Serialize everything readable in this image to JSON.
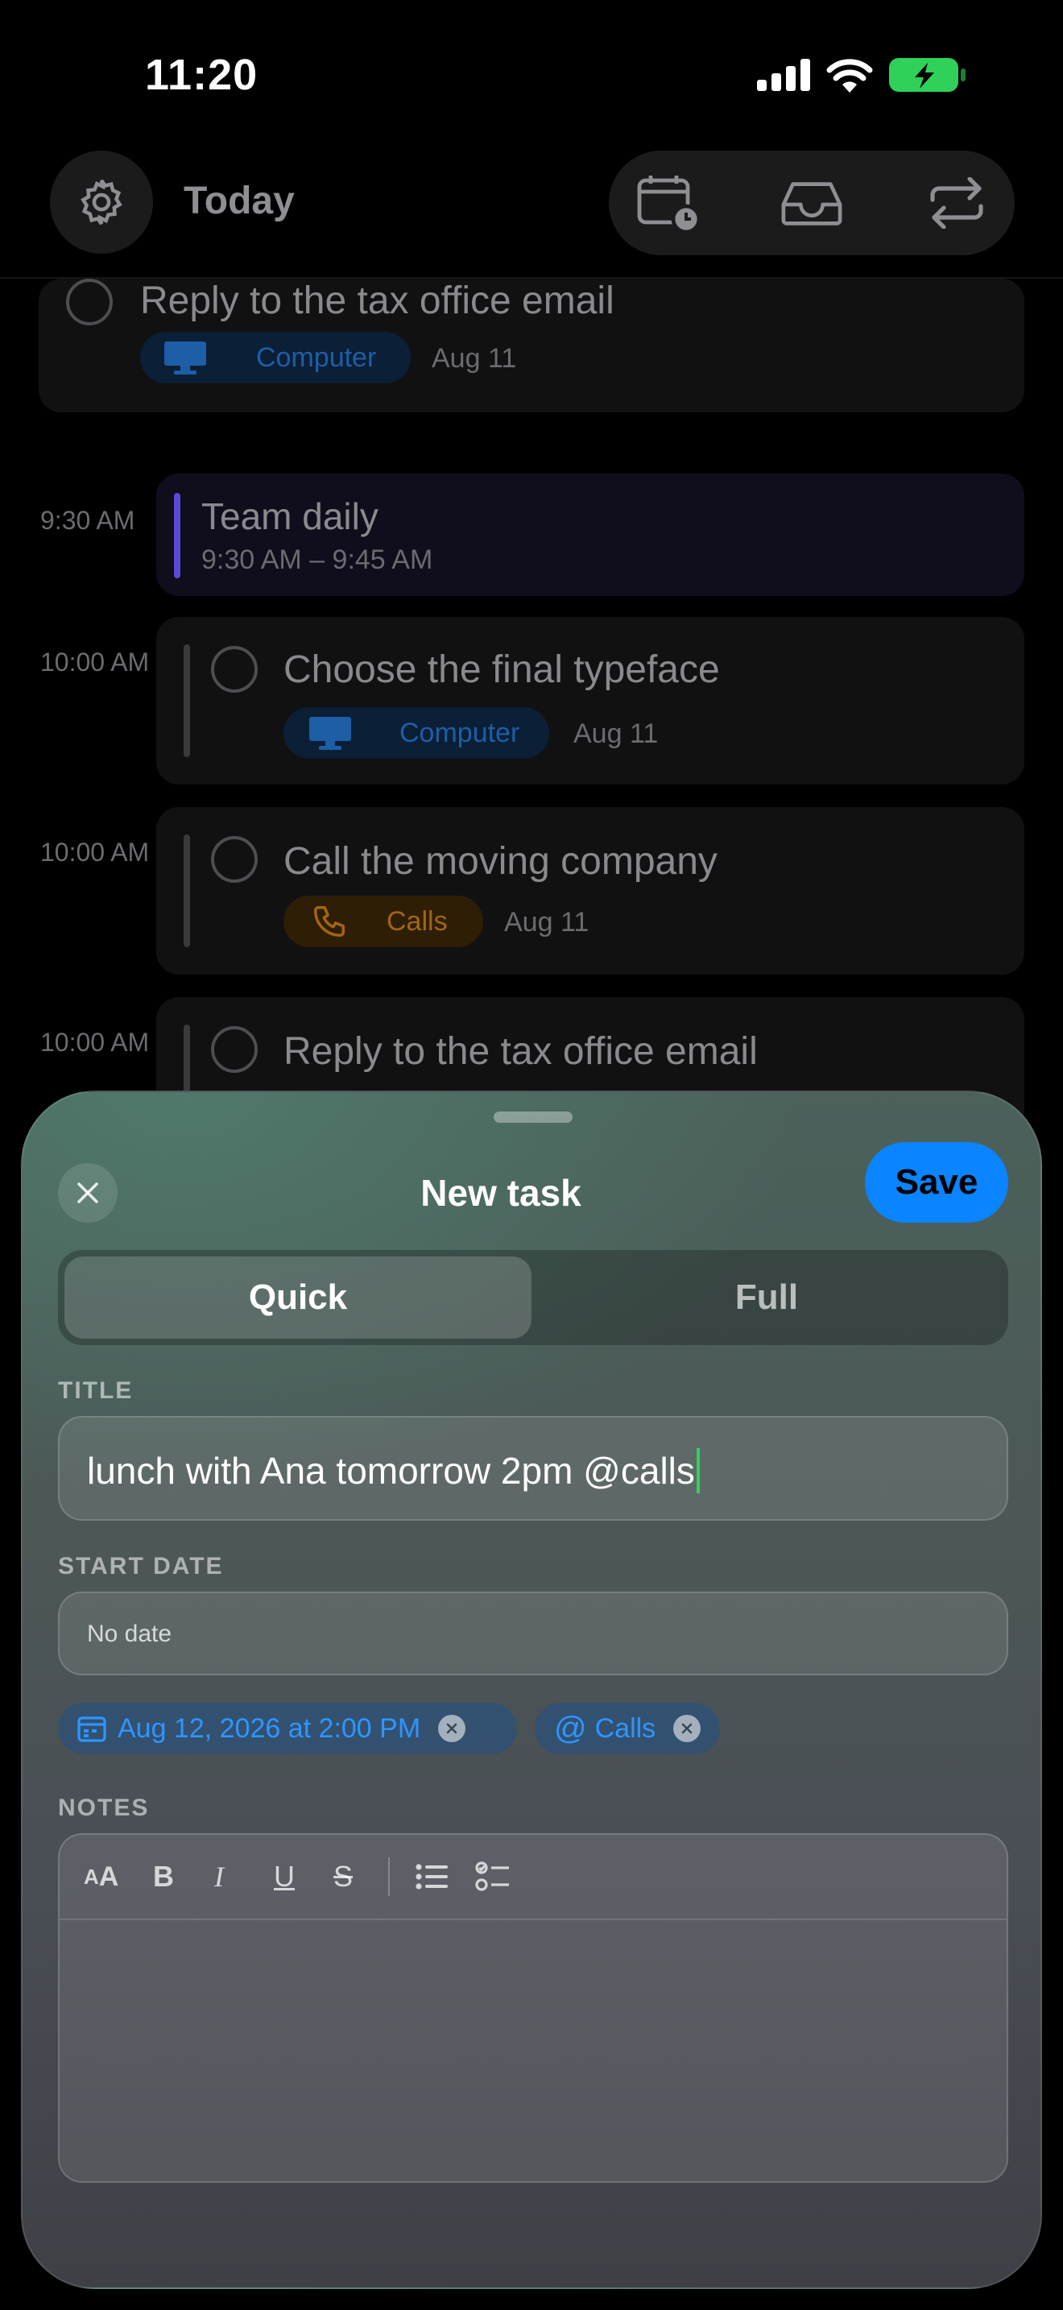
{
  "status_bar": {
    "time": "11:20"
  },
  "header": {
    "title": "Today"
  },
  "tasks": [
    {
      "title": "Reply to the tax office email",
      "tag": "Computer",
      "date": "Aug 11"
    },
    {
      "time": "9:30 AM",
      "title": "Team daily",
      "subtitle": "9:30 AM – 9:45 AM"
    },
    {
      "time": "10:00 AM",
      "title": "Choose the final typeface",
      "tag": "Computer",
      "date": "Aug 11"
    },
    {
      "time": "10:00 AM",
      "title": "Call the moving company",
      "tag": "Calls",
      "date": "Aug 11"
    },
    {
      "time": "10:00 AM",
      "title": "Reply to the tax office email"
    }
  ],
  "sheet": {
    "title": "New task",
    "save_label": "Save",
    "segments": [
      "Quick",
      "Full"
    ],
    "selected_segment": "Quick",
    "title_label": "TITLE",
    "title_value": "lunch with Ana tomorrow 2pm @calls",
    "start_date_label": "START DATE",
    "start_date_value": "No date",
    "chips": [
      {
        "icon": "calendar-icon",
        "label": "Aug 12, 2026 at 2:00 PM"
      },
      {
        "icon": "at-sign-icon",
        "label": "Calls"
      }
    ],
    "notes_label": "NOTES",
    "notes_toolbar": [
      "font-size-icon",
      "bold-icon",
      "italic-icon",
      "underline-icon",
      "strikethrough-icon",
      "bullet-list-icon",
      "checklist-icon"
    ]
  },
  "colors": {
    "accent": "#0a84ff",
    "computer_tag": "#1d5ea6",
    "calls_tag": "#a36512",
    "event_bar": "#5a4bd6",
    "caret": "#30d158"
  }
}
